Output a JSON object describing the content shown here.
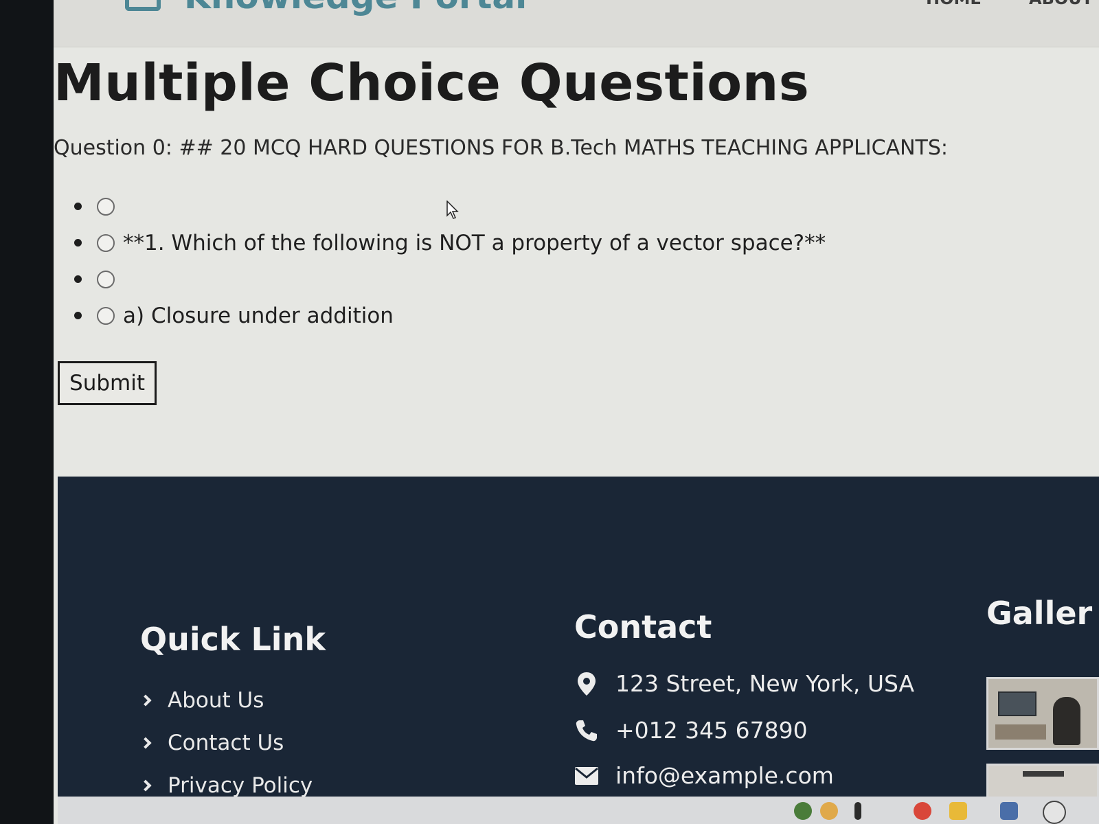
{
  "header": {
    "brand": "Knowledge Portal",
    "nav": [
      "HOME",
      "ABOUT"
    ]
  },
  "main": {
    "title": "Multiple Choice Questions",
    "question": "Question 0: ## 20 MCQ HARD QUESTIONS FOR B.Tech MATHS TEACHING APPLICANTS:",
    "options": [
      "",
      "**1. Which of the following is NOT a property of a vector space?**",
      "",
      "a) Closure under addition"
    ],
    "submit_label": "Submit"
  },
  "footer": {
    "quick_link": {
      "heading": "Quick Link",
      "items": [
        "About Us",
        "Contact Us",
        "Privacy Policy"
      ]
    },
    "contact": {
      "heading": "Contact",
      "items": [
        {
          "icon": "map-pin-icon",
          "text": "123 Street, New York, USA"
        },
        {
          "icon": "phone-icon",
          "text": "+012 345 67890"
        },
        {
          "icon": "envelope-icon",
          "text": "info@example.com"
        }
      ]
    },
    "gallery": {
      "heading": "Galler"
    }
  },
  "colors": {
    "page_background": "#e6e7e3",
    "footer_background": "#1a2636",
    "brand": "#4d8795"
  }
}
